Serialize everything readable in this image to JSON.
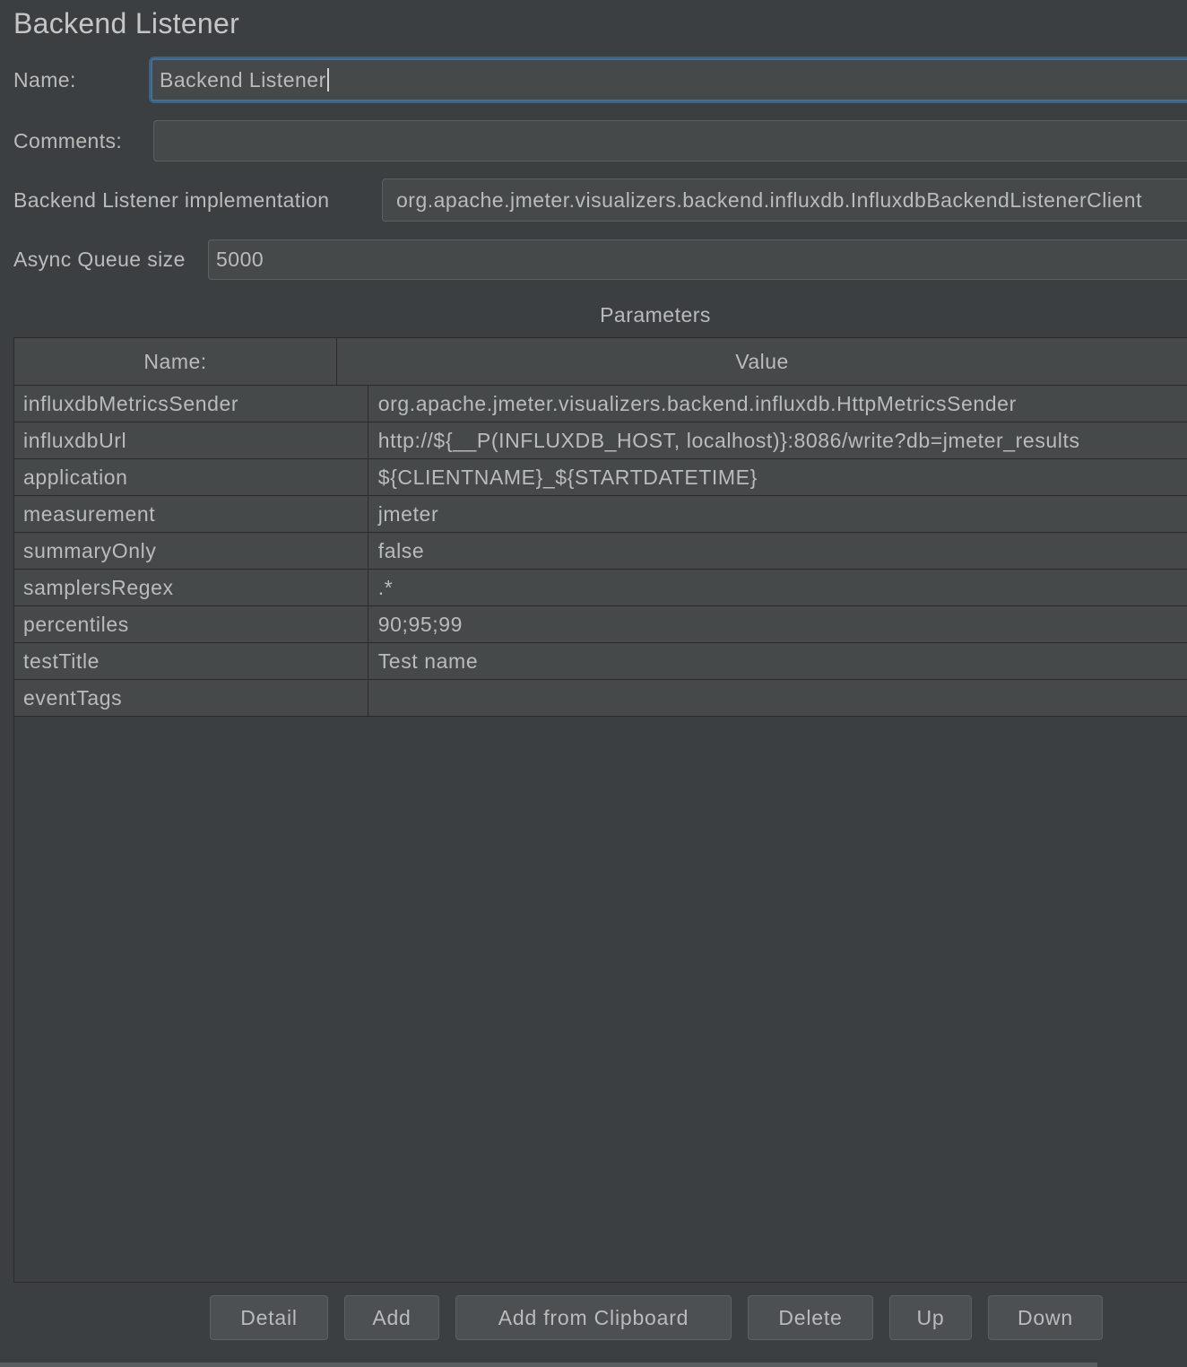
{
  "panel": {
    "title": "Backend Listener"
  },
  "form": {
    "name_label": "Name:",
    "name_value": "Backend Listener",
    "comments_label": "Comments:",
    "comments_value": "",
    "impl_label": "Backend Listener implementation",
    "impl_value": "org.apache.jmeter.visualizers.backend.influxdb.InfluxdbBackendListenerClient",
    "queue_label": "Async Queue size",
    "queue_value": "5000"
  },
  "parameters": {
    "title": "Parameters",
    "headers": {
      "name": "Name:",
      "value": "Value"
    },
    "rows": [
      {
        "name": "influxdbMetricsSender",
        "value": "org.apache.jmeter.visualizers.backend.influxdb.HttpMetricsSender"
      },
      {
        "name": "influxdbUrl",
        "value": "http://${__P(INFLUXDB_HOST, localhost)}:8086/write?db=jmeter_results"
      },
      {
        "name": "application",
        "value": "${CLIENTNAME}_${STARTDATETIME}"
      },
      {
        "name": "measurement",
        "value": "jmeter"
      },
      {
        "name": "summaryOnly",
        "value": "false"
      },
      {
        "name": "samplersRegex",
        "value": ".*"
      },
      {
        "name": "percentiles",
        "value": "90;95;99"
      },
      {
        "name": "testTitle",
        "value": "Test name"
      },
      {
        "name": "eventTags",
        "value": ""
      }
    ]
  },
  "buttons": {
    "detail": "Detail",
    "add": "Add",
    "add_clipboard": "Add from Clipboard",
    "delete": "Delete",
    "up": "Up",
    "down": "Down"
  }
}
